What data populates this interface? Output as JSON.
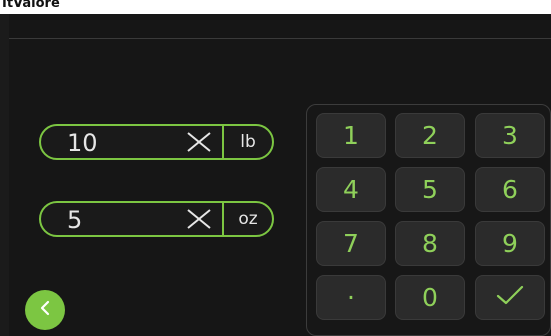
{
  "page_header": {
    "title": "ItValore"
  },
  "weight_inputs": [
    {
      "value": "10",
      "unit": "lb"
    },
    {
      "value": "5",
      "unit": "oz"
    }
  ],
  "keypad": {
    "keys": [
      "1",
      "2",
      "3",
      "4",
      "5",
      "6",
      "7",
      "8",
      "9",
      "·",
      "0",
      "✓"
    ]
  },
  "icons": {
    "clear": "close-icon",
    "confirm": "check-icon",
    "back": "chevron-left-icon"
  },
  "colors": {
    "accent": "#7cc642",
    "key_text": "#8fd05a",
    "background": "#161616",
    "key_background": "#2b2b2b"
  }
}
